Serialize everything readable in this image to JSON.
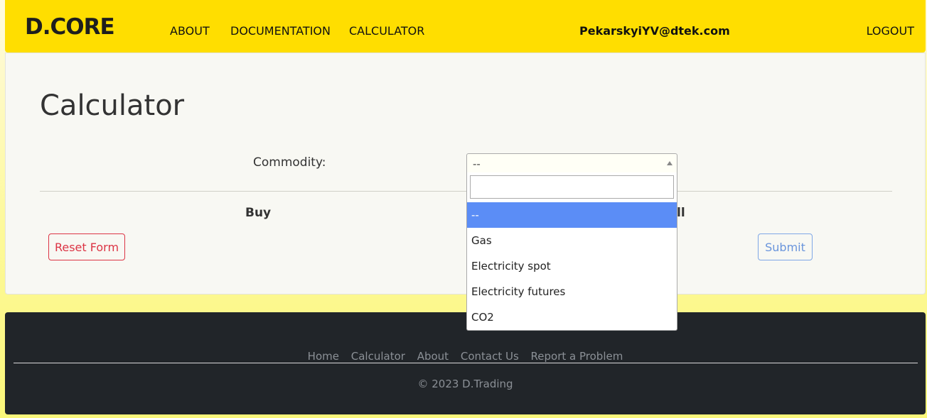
{
  "header": {
    "logo": "D.CORE",
    "nav": [
      "ABOUT",
      "DOCUMENTATION",
      "CALCULATOR"
    ],
    "user_email": "PekarskyiYV@dtek.com",
    "logout": "LOGOUT",
    "colors": {
      "bar": "#ffde00"
    }
  },
  "main": {
    "title": "Calculator",
    "commodity_label": "Commodity:",
    "commodity_selected": "--",
    "buy_label": "Buy",
    "sell_label": "ll",
    "reset_label": "Reset Form",
    "submit_label": "Submit"
  },
  "dropdown": {
    "search_value": "",
    "options": [
      "--",
      "Gas",
      "Electricity spot",
      "Electricity futures",
      "CO2"
    ],
    "selected_index": 0,
    "highlight_color": "#5b8df6"
  },
  "footer": {
    "links": [
      "Home",
      "Calculator",
      "About",
      "Contact Us",
      "Report a Problem"
    ],
    "copyright": "© 2023 D.Trading"
  }
}
